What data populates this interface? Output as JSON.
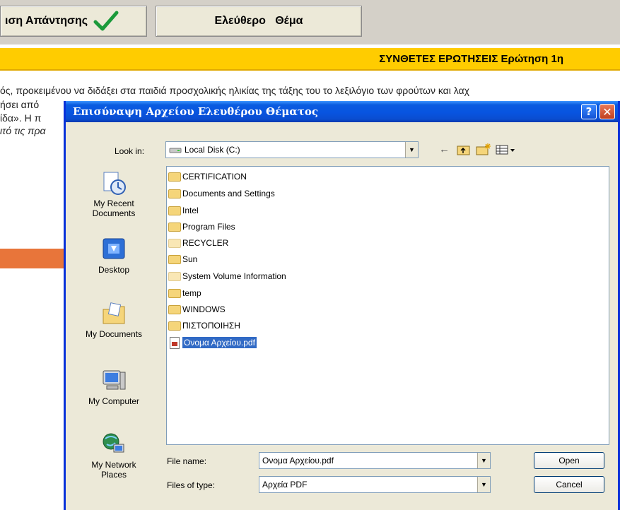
{
  "page": {
    "submit_label": "ιση Απάντησης",
    "free_topic_label": "Ελεύθερο   Θέμα",
    "question_bar": "ΣΥΝΘΕΤΕΣ ΕΡΩΤΗΣΕΙΣ Ερώτηση 1η",
    "lines": [
      "ός, προκειμένου να διδάξει στα παιδιά προσχολικής ηλικίας της τάξης του το λεξιλόγιο των φρούτων και λαχ",
      "ήσει από",
      "ίδα». Η π",
      "ιτό τις πρα"
    ]
  },
  "dialog": {
    "title": "Επισύναψη Αρχείου Ελευθέρου Θέματος",
    "help_label": "?",
    "close_label": "✕",
    "lookin_label": "Look in:",
    "lookin_value": "Local Disk (C:)",
    "places": [
      "My Recent Documents",
      "Desktop",
      "My Documents",
      "My Computer",
      "My Network Places"
    ],
    "files": [
      {
        "name": "CERTIFICATION",
        "type": "folder"
      },
      {
        "name": "Documents and Settings",
        "type": "folder"
      },
      {
        "name": "Intel",
        "type": "folder"
      },
      {
        "name": "Program Files",
        "type": "folder"
      },
      {
        "name": "RECYCLER",
        "type": "folder-hidden"
      },
      {
        "name": "Sun",
        "type": "folder"
      },
      {
        "name": "System Volume Information",
        "type": "folder-hidden"
      },
      {
        "name": "temp",
        "type": "folder"
      },
      {
        "name": "WINDOWS",
        "type": "folder"
      },
      {
        "name": "ΠΙΣΤΟΠΟΙΗΣΗ",
        "type": "folder"
      },
      {
        "name": "Ονομα Αρχείου.pdf",
        "type": "pdf",
        "selected": true
      }
    ],
    "filename_label": "File name:",
    "filename_value": "Ονομα Αρχείου.pdf",
    "filetype_label": "Files of type:",
    "filetype_value": "Αρχεία PDF",
    "open_label": "Open",
    "cancel_label": "Cancel"
  },
  "colors": {
    "title_blue": "#0a5ce0",
    "question_bar": "#ffcc00",
    "orange_band": "#e8753a",
    "selection": "#316ac5"
  }
}
